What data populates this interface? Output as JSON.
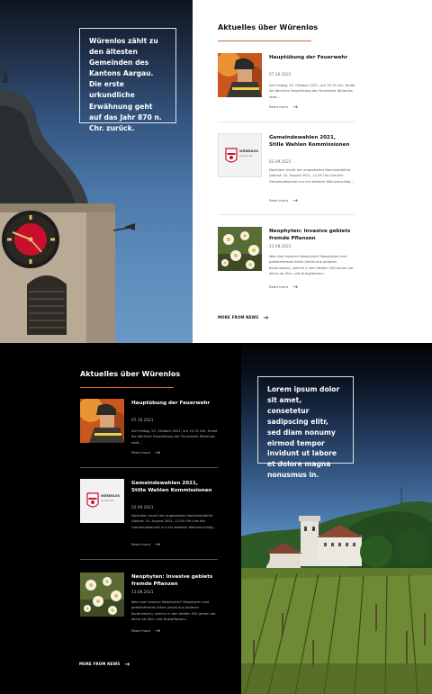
{
  "hero": {
    "quote": "Würenlos zählt zu den ältesten Gemeinden des Kantons Aargau. Die erste urkundliche Erwähnung geht auf das Jahr 870 n. Chr. zurück."
  },
  "news": {
    "title": "Aktuelles über Würenlos",
    "read_more": "Read more",
    "more_news": "MORE FROM NEWS",
    "items": [
      {
        "title": "Hauptübung der Feuerwehr",
        "date": "07.10.2021",
        "text": "Am Freitag, 22. Oktober 2021, um 19.15 Uhr, findet die jährliche Hauptübung der Feuerwehr Würenlos statt..."
      },
      {
        "title": "Gemeindewahlen 2021, Stille Wahlen Kommissionen",
        "date": "02.09.2021",
        "text": "Nachdem innert der angesetzten Nachmeldefrist (Ablauf: 24. August 2021, 12.00 Uhr) bei der Gemeindekanzlei nur ein weiterer Wahlvorschlag..."
      },
      {
        "title": "Neophyten: Invasive gebiets fremde Pflanzen",
        "date": "13.08.2021",
        "text": "Was sind invasive Neophyten? Neophyten sind gebietsfremde Arten (meist aus anderen Kontinenten), welche in den letzten 500 Jahren vor allem als Zier- und Nutzpflanzen..."
      }
    ]
  },
  "logo": {
    "name": "WÜRENLOS",
    "sub": "Gemeinde"
  },
  "hero2": {
    "quote": "Lorem ipsum dolor sit amet, consetetur sadipscing elitr, sed diam nonumy eirmod tempor invidunt ut labore et dolore magna nonusmus in."
  },
  "colors": {
    "accent": "#d36b2a",
    "dark_bg": "#000000",
    "light_bg": "#ffffff"
  }
}
